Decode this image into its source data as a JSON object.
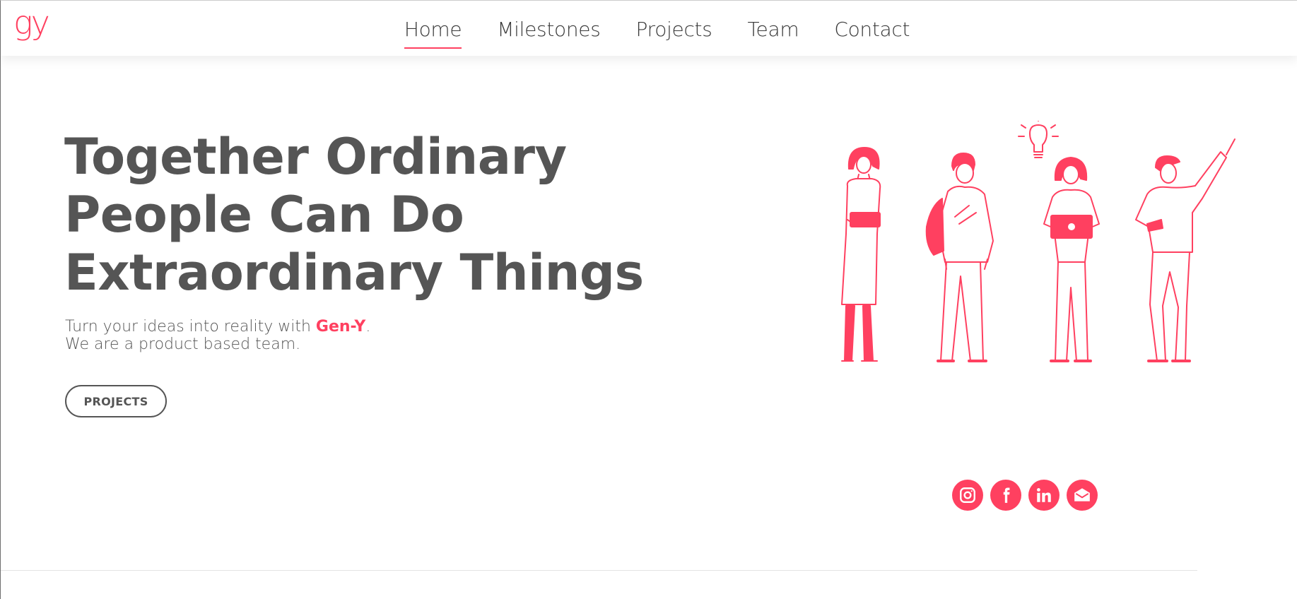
{
  "brand": {
    "logo_text": "gy",
    "accent_color": "#ff4060",
    "text_color": "#555555"
  },
  "nav": {
    "items": [
      {
        "label": "Home",
        "active": true
      },
      {
        "label": "Milestones",
        "active": false
      },
      {
        "label": "Projects",
        "active": false
      },
      {
        "label": "Team",
        "active": false
      },
      {
        "label": "Contact",
        "active": false
      }
    ]
  },
  "hero": {
    "title_lines": [
      "Together Ordinary",
      "People Can Do",
      "Extraordinary Things"
    ],
    "subtitle_prefix": "Turn your ideas into reality with ",
    "subtitle_brand": "Gen-Y",
    "subtitle_suffix": ".",
    "subtitle_line2": "We are a product based team.",
    "cta_label": "PROJECTS"
  },
  "illustration": {
    "icon": "team-people-illustration-icon"
  },
  "social": [
    {
      "name": "instagram",
      "icon": "instagram-icon"
    },
    {
      "name": "facebook",
      "icon": "facebook-icon"
    },
    {
      "name": "linkedin",
      "icon": "linkedin-icon"
    },
    {
      "name": "email",
      "icon": "mail-icon"
    }
  ]
}
